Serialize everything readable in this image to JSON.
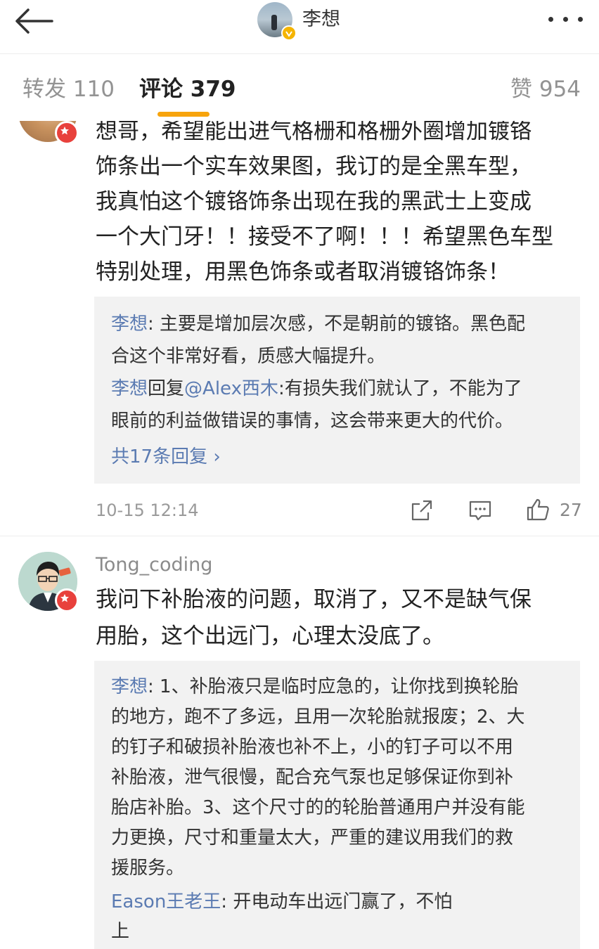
{
  "nav": {
    "title": "李想"
  },
  "tabs": [
    {
      "label": "转发 110"
    },
    {
      "label": "评论 379"
    },
    {
      "label": "赞 954"
    }
  ],
  "comment1": {
    "lines": [
      "想哥，希望能出进气格栅和格栅外圈增加镀铬",
      "饰条出一个实车效果图，我订的是全黑车型，",
      "我真怕这个镀铬饰条出现在我的黑武士上变成",
      "一个大门牙！！接受不了啊！！！希望黑色车型",
      "特别处理，用黑色饰条或者取消镀铬饰条！"
    ],
    "replies": [
      {
        "user": "李想",
        "line1": ": 主要是增加层次感，不是朝前的镀铬。黑色配",
        "line2": "合这个非常好看，质感大幅提升。"
      },
      {
        "user": "李想",
        "mid": "回复",
        "target": "@Alex西木",
        "line1": ":有损失我们就认了，不能为了",
        "line2": "眼前的利益做错误的事情，这会带来更大的代价。"
      }
    ],
    "more_replies": "共17条回复 ›",
    "time": "10-15 12:14",
    "like_count": "27"
  },
  "comment2": {
    "username": "Tong_coding",
    "lines": [
      "我问下补胎液的问题，取消了，又不是缺气保",
      "用胎，这个出远门，心理太没底了。"
    ],
    "reply1_user": "李想",
    "reply1_lines": [
      ": 1、补胎液只是临时应急的，让你找到换轮胎",
      "的地方，跑不了多远，且用一次轮胎就报废；2、大",
      "的钉子和破损补胎液也补不上，小的钉子可以不用",
      "补胎液，泄气很慢，配合充气泵也足够保证你到补",
      "胎店补胎。3、这个尺寸的的轮胎普通用户并没有能",
      "力更换，尺寸和重量太大，严重的建议用我们的救",
      "援服务。"
    ],
    "reply2_user": "Eason王老王",
    "reply2_line1": ": 开电动车出远门赢了，不怕",
    "reply2_line2": "上"
  }
}
